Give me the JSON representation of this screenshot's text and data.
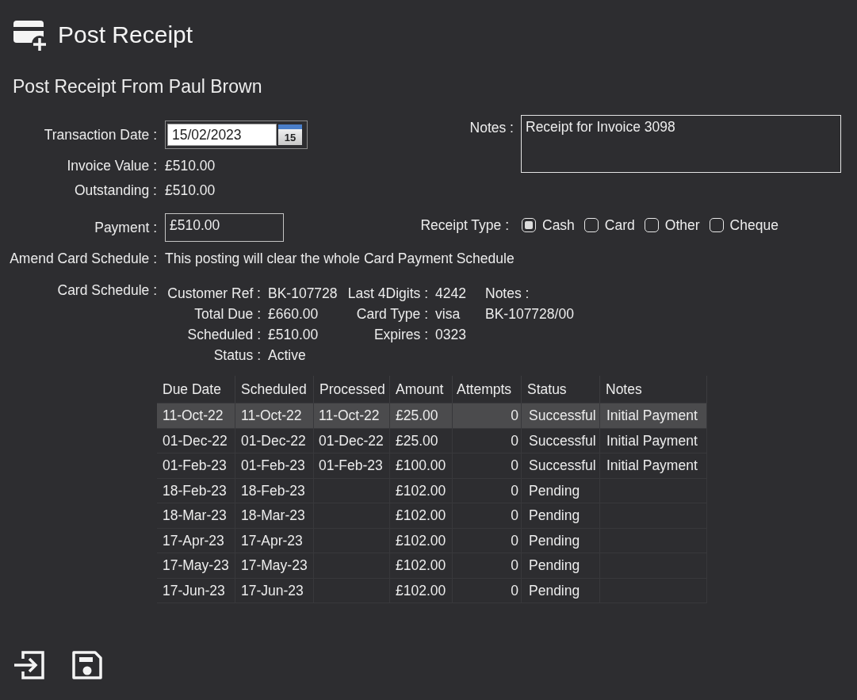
{
  "header": {
    "title": "Post Receipt"
  },
  "subtitle": "Post Receipt From Paul Brown",
  "transaction_date": {
    "label": "Transaction Date :",
    "value": "15/02/2023",
    "calendar_day": "15"
  },
  "invoice_value": {
    "label": "Invoice Value :",
    "value": "£510.00"
  },
  "outstanding": {
    "label": "Outstanding :",
    "value": "£510.00"
  },
  "payment": {
    "label": "Payment :",
    "value": "£510.00"
  },
  "notes": {
    "label": "Notes :",
    "value": "Receipt for Invoice 3098"
  },
  "receipt_type": {
    "label": "Receipt Type :",
    "options": [
      {
        "label": "Cash",
        "selected": true
      },
      {
        "label": "Card",
        "selected": false
      },
      {
        "label": "Other",
        "selected": false
      },
      {
        "label": "Cheque",
        "selected": false
      }
    ]
  },
  "amend_card_schedule": {
    "label": "Amend Card Schedule :",
    "value": "This posting will clear the whole Card Payment Schedule"
  },
  "card_schedule": {
    "label": "Card Schedule :",
    "fields": [
      {
        "label": "Customer Ref :",
        "value": "BK-107728"
      },
      {
        "label": "Total Due :",
        "value": "£660.00"
      },
      {
        "label": "Scheduled :",
        "value": "£510.00"
      },
      {
        "label": "Status :",
        "value": "Active"
      }
    ],
    "card_fields": [
      {
        "label": "Last 4Digits :",
        "value": "4242"
      },
      {
        "label": "Card Type :",
        "value": "visa"
      },
      {
        "label": "Expires :",
        "value": "0323"
      }
    ],
    "notes": {
      "label": "Notes :",
      "value": "BK-107728/00"
    }
  },
  "table": {
    "columns": [
      "Due Date",
      "Scheduled",
      "Processed",
      "Amount",
      "Attempts",
      "Status",
      "Notes"
    ],
    "rows": [
      {
        "selected": true,
        "due_date": "11-Oct-22",
        "scheduled": "11-Oct-22",
        "processed": "11-Oct-22",
        "amount": "£25.00",
        "attempts": "0",
        "status": "Successful",
        "notes": "Initial Payment"
      },
      {
        "selected": false,
        "due_date": "01-Dec-22",
        "scheduled": "01-Dec-22",
        "processed": "01-Dec-22",
        "amount": "£25.00",
        "attempts": "0",
        "status": "Successful",
        "notes": "Initial Payment"
      },
      {
        "selected": false,
        "due_date": "01-Feb-23",
        "scheduled": "01-Feb-23",
        "processed": "01-Feb-23",
        "amount": "£100.00",
        "attempts": "0",
        "status": "Successful",
        "notes": "Initial Payment"
      },
      {
        "selected": false,
        "due_date": "18-Feb-23",
        "scheduled": "18-Feb-23",
        "amount": "£102.00",
        "attempts": "0",
        "status": "Pending"
      },
      {
        "selected": false,
        "due_date": "18-Mar-23",
        "scheduled": "18-Mar-23",
        "amount": "£102.00",
        "attempts": "0",
        "status": "Pending"
      },
      {
        "selected": false,
        "due_date": "17-Apr-23",
        "scheduled": "17-Apr-23",
        "amount": "£102.00",
        "attempts": "0",
        "status": "Pending"
      },
      {
        "selected": false,
        "due_date": "17-May-23",
        "scheduled": "17-May-23",
        "amount": "£102.00",
        "attempts": "0",
        "status": "Pending"
      },
      {
        "selected": false,
        "due_date": "17-Jun-23",
        "scheduled": "17-Jun-23",
        "amount": "£102.00",
        "attempts": "0",
        "status": "Pending"
      }
    ]
  }
}
